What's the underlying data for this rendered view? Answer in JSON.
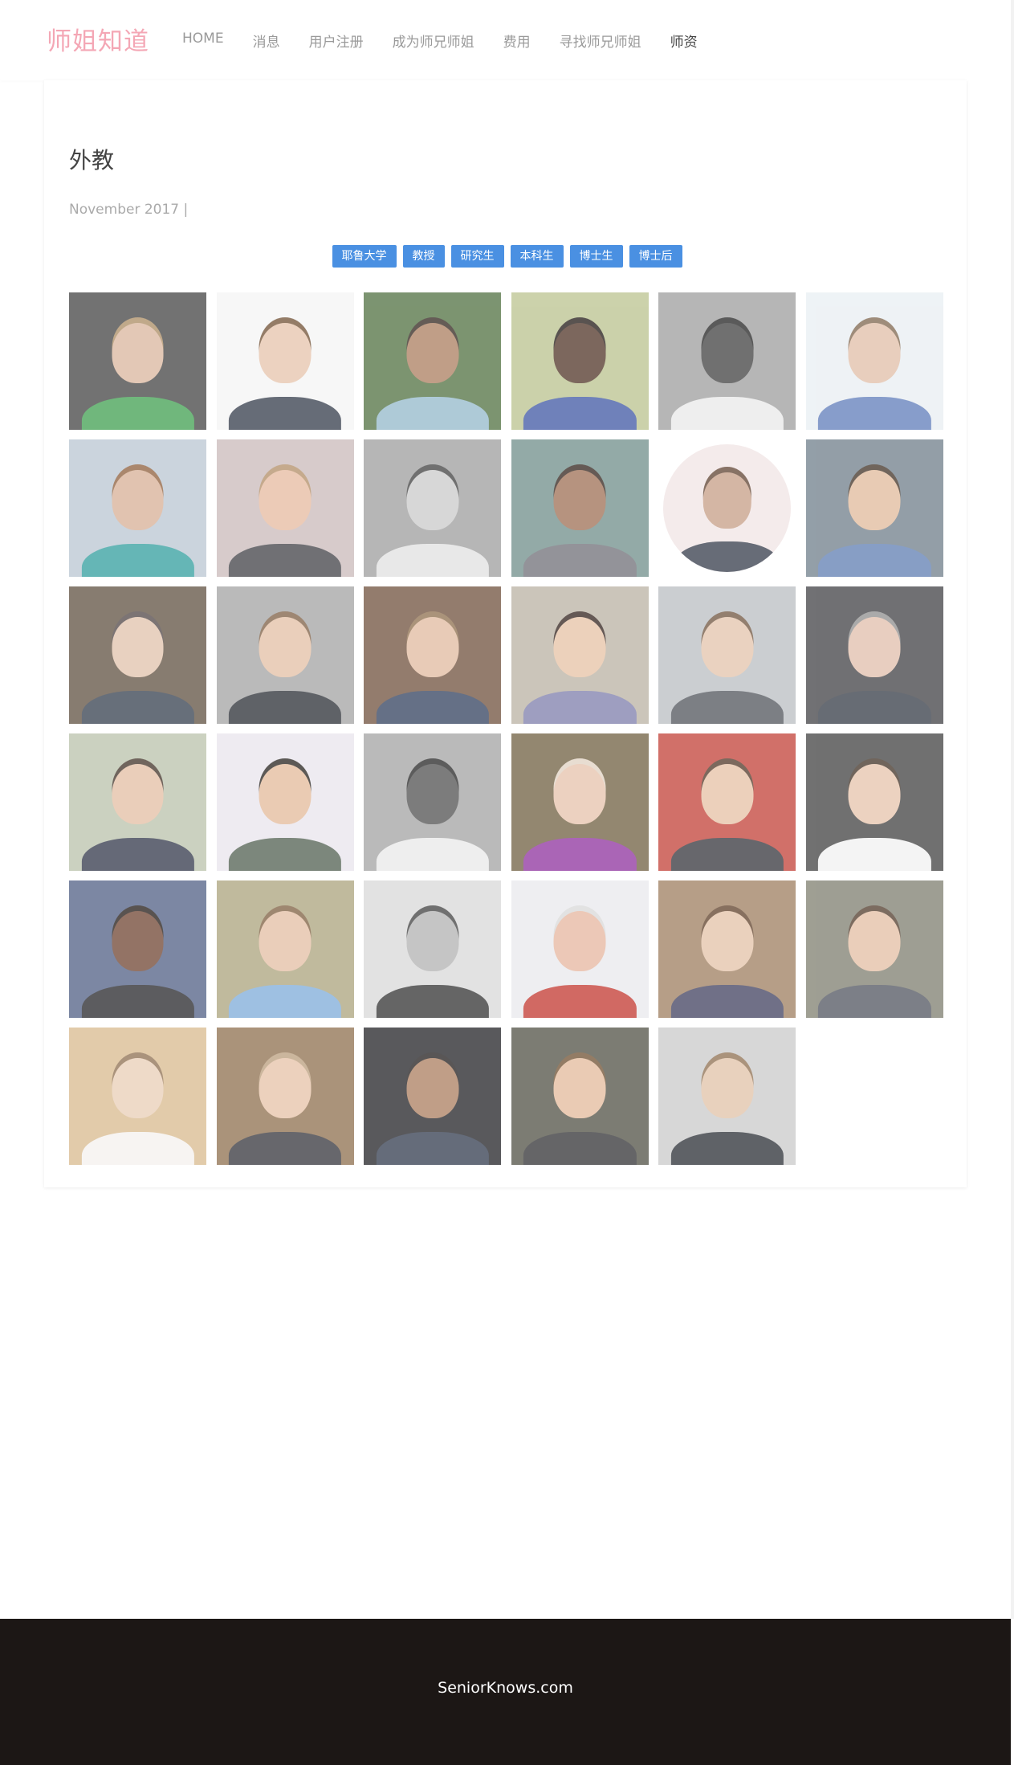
{
  "site": {
    "logo": "师姐知道"
  },
  "nav": {
    "items": [
      {
        "label": "HOME"
      },
      {
        "label": "消息"
      },
      {
        "label": "用户注册"
      },
      {
        "label": "成为师兄师姐"
      },
      {
        "label": "费用"
      },
      {
        "label": "寻找师兄师姐"
      },
      {
        "label": "师资"
      }
    ],
    "active_index": 6
  },
  "post": {
    "title": "外教",
    "meta": "November 2017 |"
  },
  "tags": [
    "耶鲁大学",
    "教授",
    "研究生",
    "本科生",
    "博士生",
    "博士后"
  ],
  "colors": {
    "brand_pink": "#f4a7b5",
    "tag_blue": "#4a90e2",
    "footer_bg": "#1c1715"
  },
  "photos": [
    {
      "bg": "#3c3c3c",
      "skin": "#d9b49a",
      "hair": "#a9895e",
      "shirt": "#3a9c4a"
    },
    {
      "bg": "#f4f4f4",
      "skin": "#e6c2a8",
      "hair": "#6b4a2e",
      "shirt": "#2c3444"
    },
    {
      "bg": "#4a6b3a",
      "skin": "#a97a5a",
      "hair": "#2a1e16",
      "shirt": "#8fb6c8"
    },
    {
      "bg": "#b8c08a",
      "skin": "#4a2e20",
      "hair": "#1a120e",
      "shirt": "#3852a0"
    },
    {
      "bg": "#9a9a9a",
      "skin": "#3a3a3a",
      "hair": "#1c1c1c",
      "shirt": "#e8e8e8"
    },
    {
      "bg": "#e8eef2",
      "skin": "#e0bca4",
      "hair": "#7a6048",
      "shirt": "#5a78b8"
    },
    {
      "bg": "#b8c4d0",
      "skin": "#d6ad92",
      "hair": "#8a5a36",
      "shirt": "#2a9a9a"
    },
    {
      "bg": "#c8b8b8",
      "skin": "#e6b89c",
      "hair": "#b08a62",
      "shirt": "#3a3a40"
    },
    {
      "bg": "#9a9a9a",
      "skin": "#c8c8c8",
      "hair": "#3a3a3a",
      "shirt": "#e0e0e0"
    },
    {
      "bg": "#6a8a86",
      "skin": "#9a6a4e",
      "hair": "#2a1c14",
      "shirt": "#6a6a72"
    },
    {
      "bg": "#ffffff",
      "skin": "#c49a82",
      "hair": "#5a3c2a",
      "shirt": "#2e3444",
      "round": true
    },
    {
      "bg": "#6a7a86",
      "skin": "#e0b898",
      "hair": "#3a2a1e",
      "shirt": "#5a7ab0"
    },
    {
      "bg": "#5a4a3a",
      "skin": "#e0c0a8",
      "hair": "#4a4040",
      "shirt": "#2e3848"
    },
    {
      "bg": "#a0a0a0",
      "skin": "#e2bda2",
      "hair": "#7a5a3e",
      "shirt": "#22262e"
    },
    {
      "bg": "#6a4a36",
      "skin": "#e0b89c",
      "hair": "#8a6a48",
      "shirt": "#2a3a58"
    },
    {
      "bg": "#b8b0a0",
      "skin": "#e6c0a2",
      "hair": "#2a1a14",
      "shirt": "#7a7aa8"
    },
    {
      "bg": "#b8bcc0",
      "skin": "#e2c2a8",
      "hair": "#6a4e38",
      "shirt": "#4a4e56"
    },
    {
      "bg": "#3a3a3e",
      "skin": "#e0bca8",
      "hair": "#8a8a8a",
      "shirt": "#2e3440"
    },
    {
      "bg": "#b8c0a8",
      "skin": "#e2bca0",
      "hair": "#3a2a20",
      "shirt": "#2a3044"
    },
    {
      "bg": "#e8e4ec",
      "skin": "#e2b896",
      "hair": "#1e1a16",
      "shirt": "#4a5a4a"
    },
    {
      "bg": "#a0a0a0",
      "skin": "#4a4a4a",
      "hair": "#1e1e1e",
      "shirt": "#e8e8e8"
    },
    {
      "bg": "#6a5a3a",
      "skin": "#e6c0a8",
      "hair": "#e0d0c0",
      "shirt": "#8a2a9a"
    },
    {
      "bg": "#c03a30",
      "skin": "#e6bea2",
      "hair": "#4a3020",
      "shirt": "#2e2e34"
    },
    {
      "bg": "#3a3a3a",
      "skin": "#e6c2a8",
      "hair": "#3a2a1e",
      "shirt": "#f0f0f0"
    },
    {
      "bg": "#4a5a80",
      "skin": "#6a3e2a",
      "hair": "#1a120e",
      "shirt": "#1e1e22"
    },
    {
      "bg": "#a8a078",
      "skin": "#e2bca0",
      "hair": "#7a5a3a",
      "shirt": "#7aa8d8"
    },
    {
      "bg": "#d8d8d8",
      "skin": "#b0b0b0",
      "hair": "#3a3a3a",
      "shirt": "#2a2a2a"
    },
    {
      "bg": "#e8e8ec",
      "skin": "#e6b49c",
      "hair": "#d8d8d8",
      "shirt": "#c03028"
    },
    {
      "bg": "#9a7a5a",
      "skin": "#e2c0a4",
      "hair": "#5a3a22",
      "shirt": "#3a3a5a"
    },
    {
      "bg": "#7a7a6a",
      "skin": "#e2bca0",
      "hair": "#4a3424",
      "shirt": "#4a4e5a"
    },
    {
      "bg": "#d8b88a",
      "skin": "#e8ccb4",
      "hair": "#8a6a4a",
      "shirt": "#f4f0ee"
    },
    {
      "bg": "#8a6a48",
      "skin": "#e6c0a4",
      "hair": "#b89a78",
      "shirt": "#2e2e34"
    },
    {
      "bg": "#1a1a1e",
      "skin": "#a87a5a",
      "hair": "#1a1616",
      "shirt": "#2a3448"
    },
    {
      "bg": "#4a4a3e",
      "skin": "#e2b898",
      "hair": "#6a4a2a",
      "shirt": "#2a2a2e"
    },
    {
      "bg": "#c8c8c8",
      "skin": "#e0c0a4",
      "hair": "#8a6a4a",
      "shirt": "#22262e"
    }
  ],
  "footer": {
    "text": "SeniorKnows.com"
  }
}
